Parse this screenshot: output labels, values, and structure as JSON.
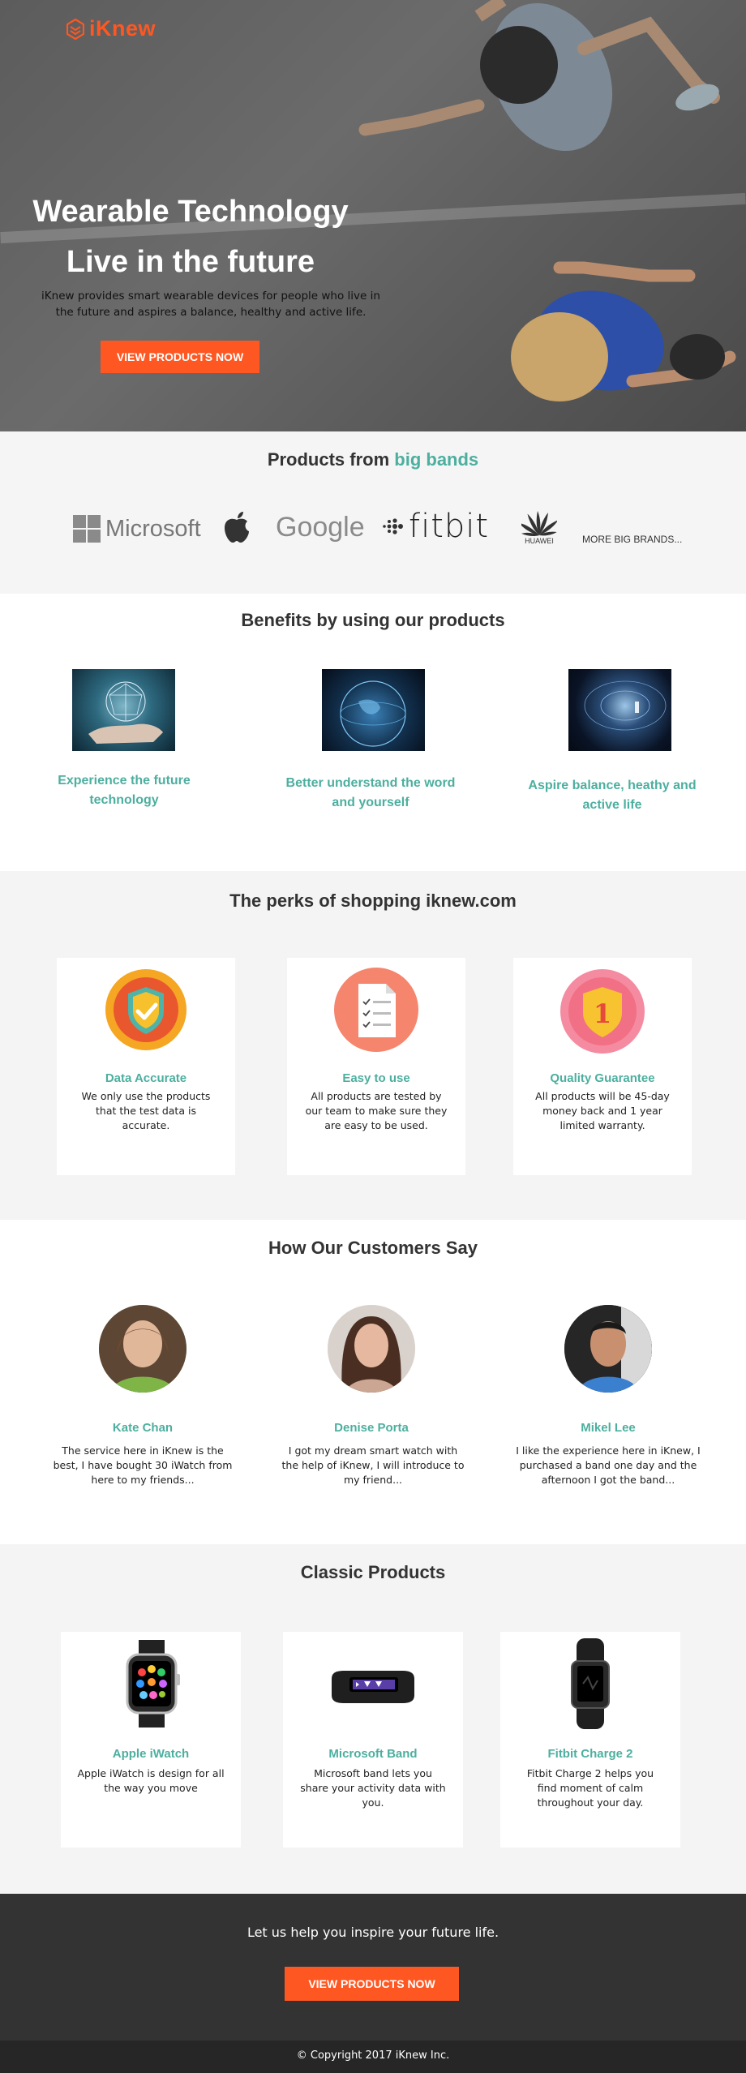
{
  "hero": {
    "logo_text": "iKnew",
    "title_line1": "Wearable Technology",
    "title_line2": "Live in the future",
    "description": "iKnew provides smart wearable devices for people who live in the future and  aspires a balance, healthy and active life.",
    "button_label": "VIEW PRODUCTS NOW"
  },
  "brands": {
    "title_prefix": "Products from ",
    "title_accent": "big bands",
    "items": [
      "Microsoft",
      "apple",
      "Google",
      "fitbit",
      "HUAWEI",
      "MORE BIG BRANDS..."
    ]
  },
  "benefits": {
    "title": "Benefits by using our products",
    "items": [
      {
        "label": "Experience the future technology",
        "image": "hand-network-image"
      },
      {
        "label": "Better understand the word and yourself",
        "image": "digital-earth-image"
      },
      {
        "label": "Aspire balance, heathy and active life",
        "image": "future-tunnel-image"
      }
    ]
  },
  "perks": {
    "title": "The perks of shopping iknew.com",
    "items": [
      {
        "title": "Data Accurate",
        "text": "We only use the products that the test data is accurate.",
        "icon": "shield-check-icon"
      },
      {
        "title": "Easy to use",
        "text": "All products are tested by our team to make sure they are easy to be used.",
        "icon": "checklist-document-icon"
      },
      {
        "title": "Quality Guarantee",
        "text": "All products will be  45-day money back and 1 year limited warranty.",
        "icon": "badge-number-one-icon"
      }
    ]
  },
  "testimonials": {
    "title": "How Our Customers Say",
    "items": [
      {
        "name": "Kate Chan",
        "quote": "The service here in iKnew is the best, I have bought 30 iWatch from here to my friends..."
      },
      {
        "name": "Denise Porta",
        "quote": "I got my dream smart watch with the help of iKnew, I will introduce to my friend..."
      },
      {
        "name": "Mikel Lee",
        "quote": "I like the experience here in iKnew, I purchased a band one day and the afternoon I got the band..."
      }
    ]
  },
  "products": {
    "title": "Classic Products",
    "items": [
      {
        "name": "Apple iWatch",
        "text": "Apple iWatch is design for all the way you move"
      },
      {
        "name": "Microsoft Band",
        "text": "Microsoft band lets you share your activity data with you."
      },
      {
        "name": "Fitbit Charge 2",
        "text": "Fitbit Charge 2 helps you find moment of calm throughout your day."
      }
    ]
  },
  "cta": {
    "text": "Let us help you inspire your future life.",
    "button_label": "VIEW PRODUCTS NOW"
  },
  "footer": {
    "copyright": "© Copyright 2017 iKnew Inc."
  },
  "colors": {
    "accent_orange": "#ff5722",
    "accent_teal": "#4caf9f",
    "dark_bg": "#333333"
  }
}
